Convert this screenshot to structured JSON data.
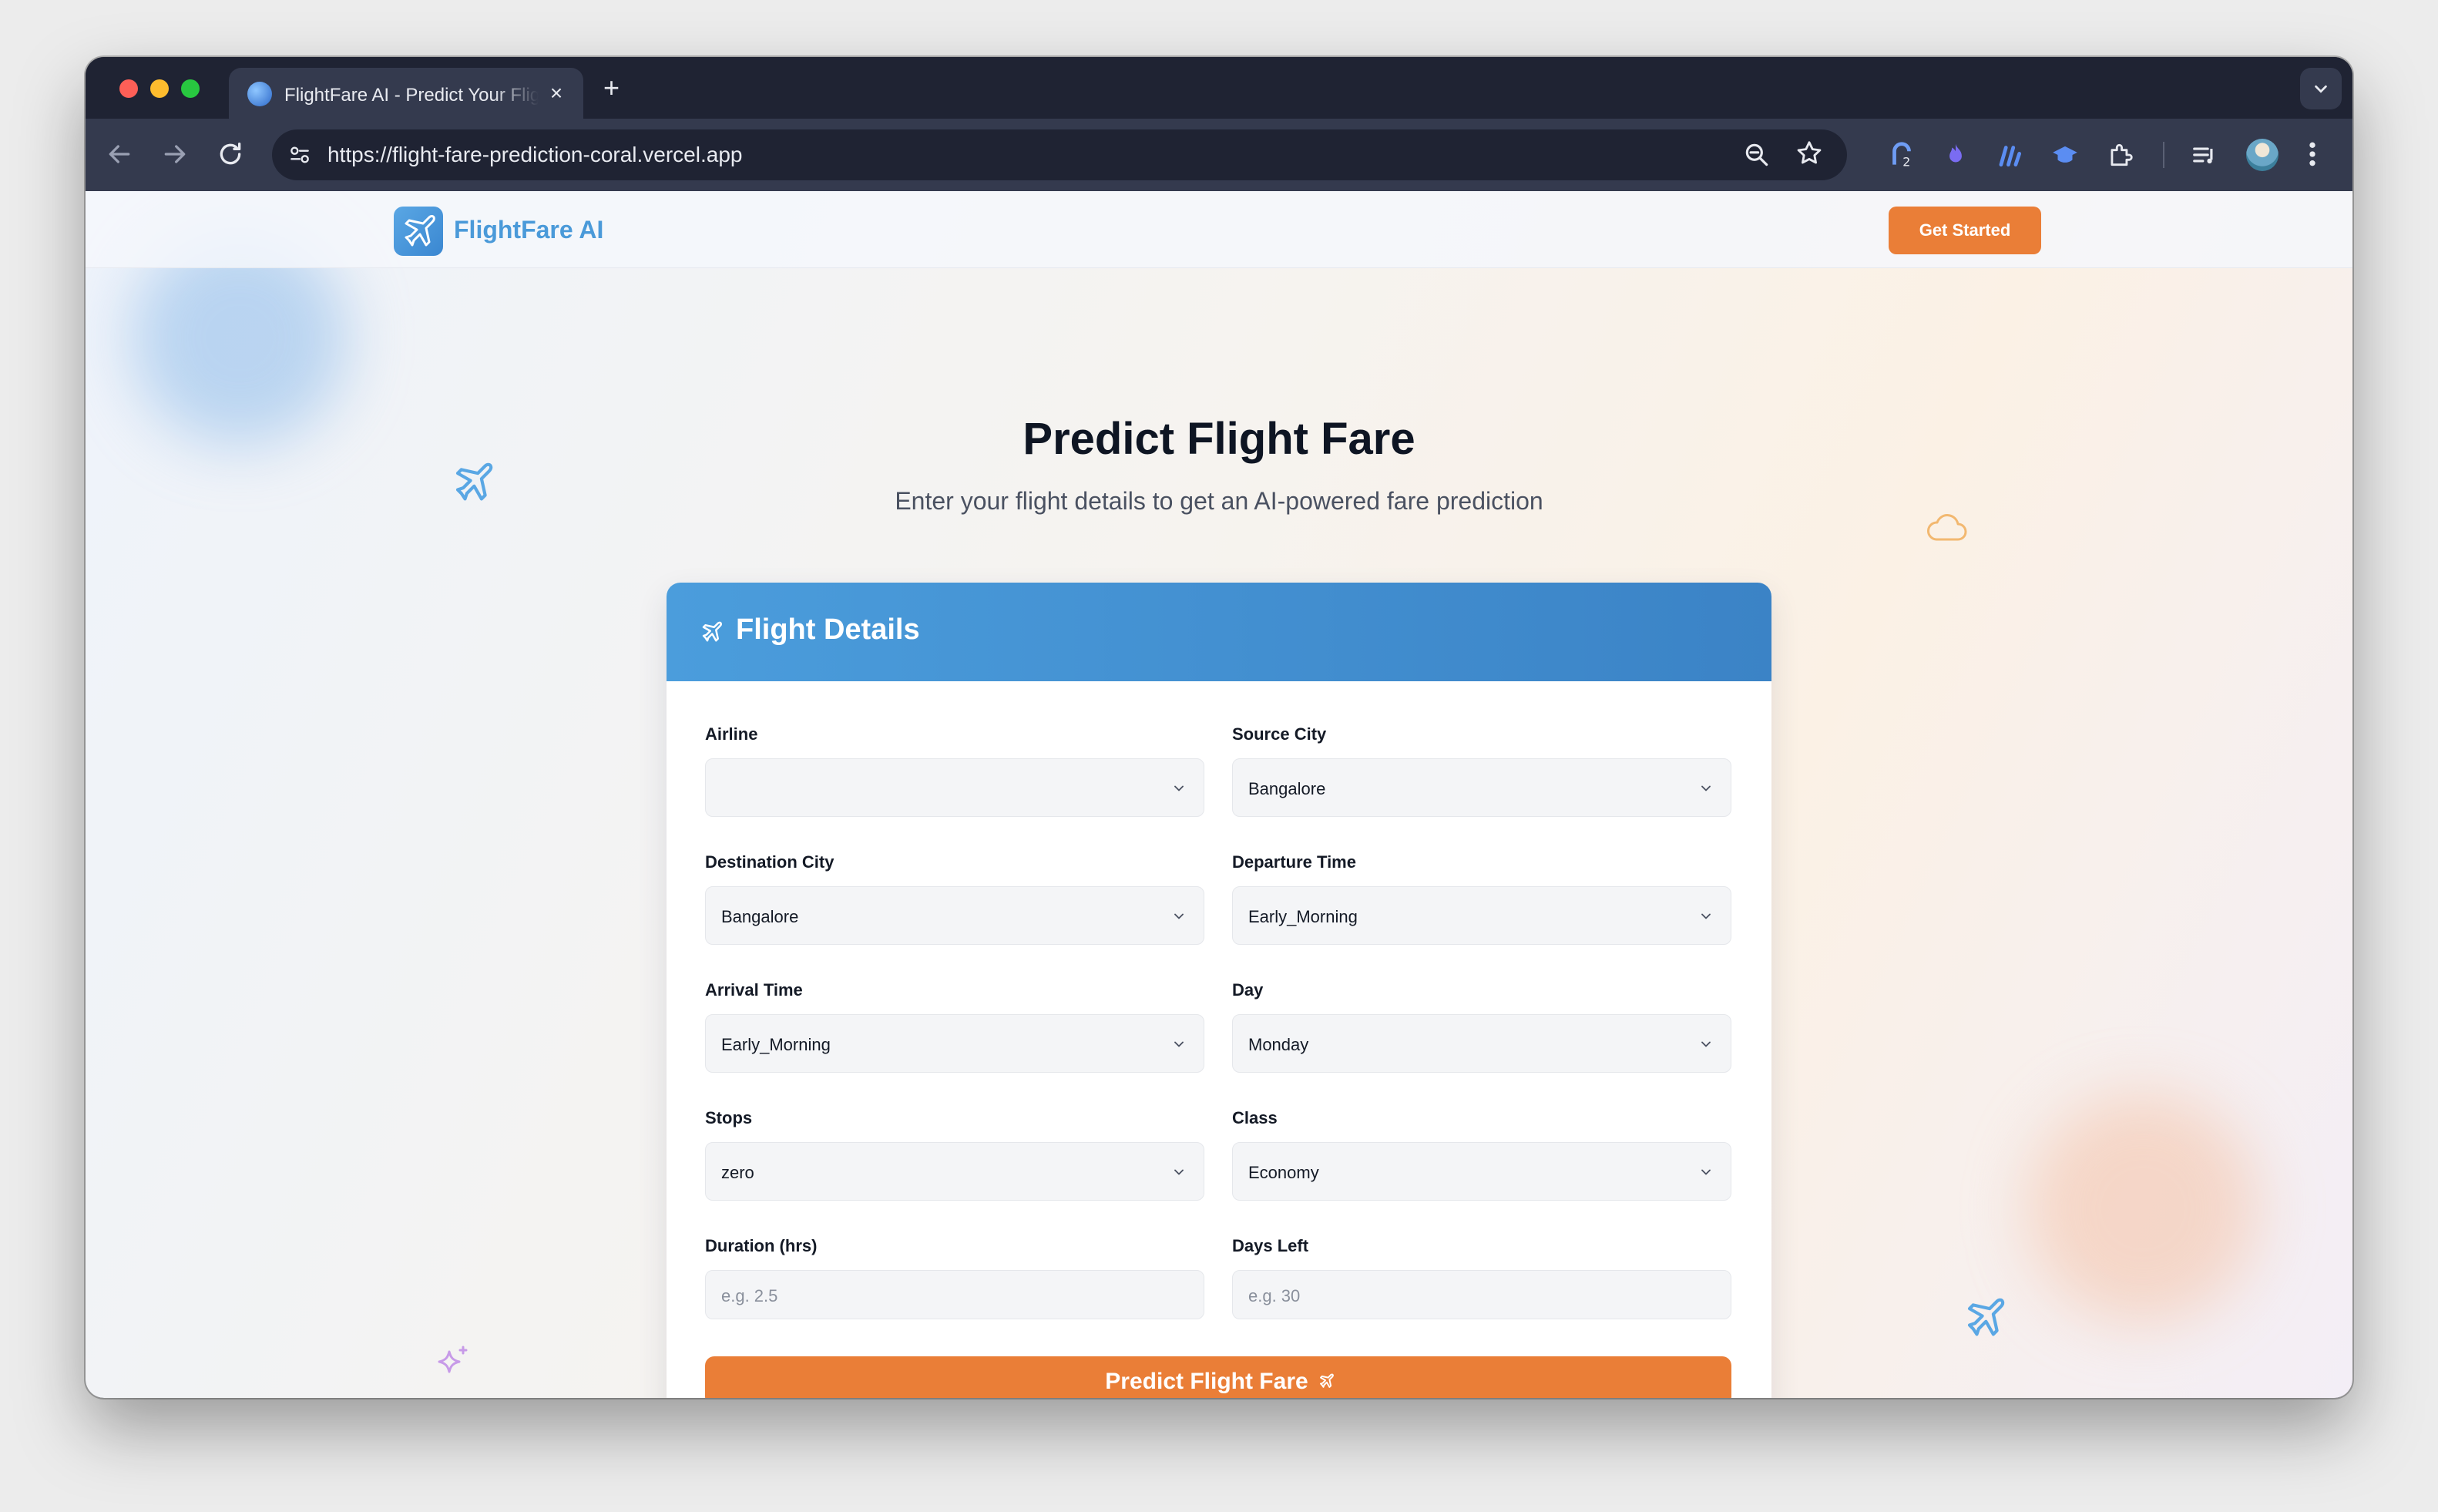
{
  "browser": {
    "tab_title": "FlightFare AI - Predict Your Flight Fare",
    "tab_close": "×",
    "new_tab": "+",
    "url": "https://flight-fare-prediction-coral.vercel.app",
    "extension_badge": "2"
  },
  "nav": {
    "brand": "FlightFare AI",
    "cta": "Get Started"
  },
  "hero": {
    "title": "Predict Flight Fare",
    "subtitle": "Enter your flight details to get an AI-powered fare prediction"
  },
  "form": {
    "title": "Flight Details",
    "fields": {
      "airline": {
        "label": "Airline",
        "value": ""
      },
      "source_city": {
        "label": "Source City",
        "value": "Bangalore"
      },
      "destination_city": {
        "label": "Destination City",
        "value": "Bangalore"
      },
      "departure_time": {
        "label": "Departure Time",
        "value": "Early_Morning"
      },
      "arrival_time": {
        "label": "Arrival Time",
        "value": "Early_Morning"
      },
      "day": {
        "label": "Day",
        "value": "Monday"
      },
      "stops": {
        "label": "Stops",
        "value": "zero"
      },
      "class": {
        "label": "Class",
        "value": "Economy"
      },
      "duration": {
        "label": "Duration (hrs)",
        "placeholder": "e.g. 2.5"
      },
      "days_left": {
        "label": "Days Left",
        "placeholder": "e.g. 30"
      }
    },
    "submit": "Predict Flight Fare"
  },
  "colors": {
    "accent_orange": "#ea7e37",
    "brand_blue": "#4a9ad9",
    "header_blue": "#4b9ddc"
  },
  "icons": [
    "plane-icon",
    "cloud-icon",
    "sparkle-icon",
    "chevron-down-icon",
    "search-icon",
    "star-icon"
  ]
}
